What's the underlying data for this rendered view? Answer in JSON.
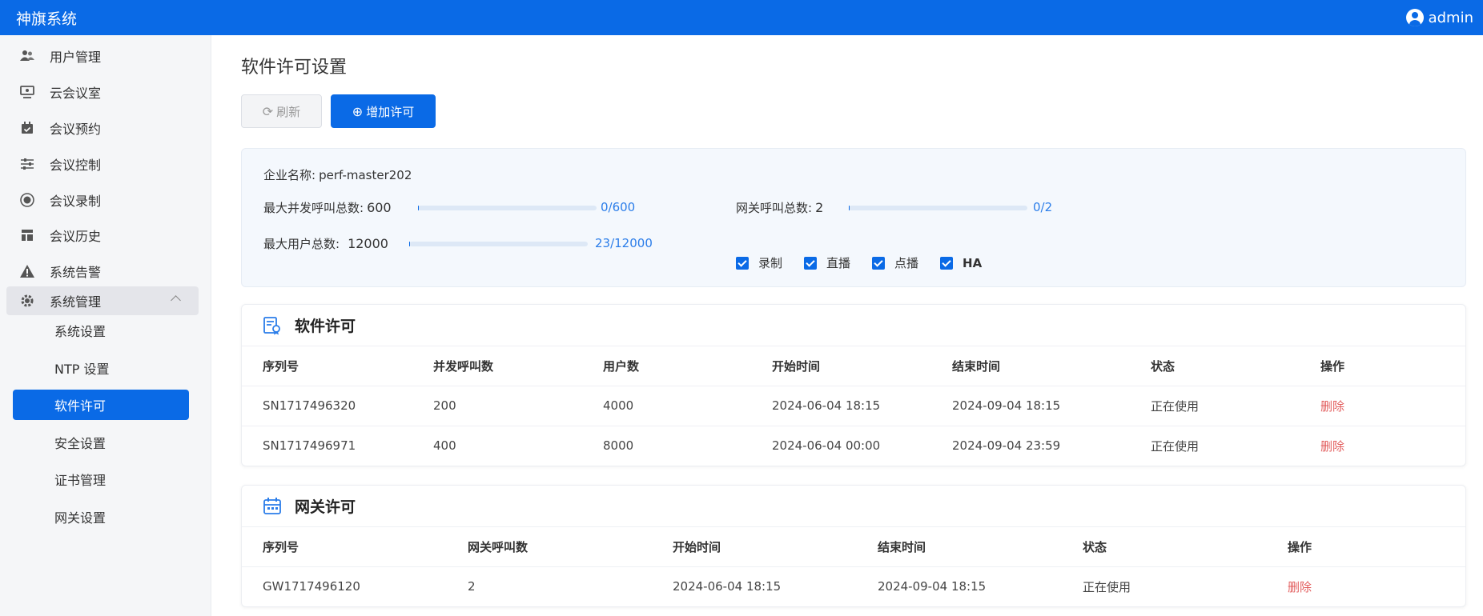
{
  "app": {
    "title": "神旗系统",
    "user": "admin"
  },
  "sidebar": {
    "items": [
      {
        "label": "用户管理",
        "icon": "users-icon"
      },
      {
        "label": "云会议室",
        "icon": "meeting-room-icon"
      },
      {
        "label": "会议预约",
        "icon": "calendar-check-icon"
      },
      {
        "label": "会议控制",
        "icon": "sliders-icon"
      },
      {
        "label": "会议录制",
        "icon": "record-icon"
      },
      {
        "label": "会议历史",
        "icon": "history-layout-icon"
      },
      {
        "label": "系统告警",
        "icon": "warning-icon"
      },
      {
        "label": "系统管理",
        "icon": "gear-icon"
      }
    ],
    "subitems": [
      {
        "label": "系统设置"
      },
      {
        "label": "NTP 设置"
      },
      {
        "label": "软件许可"
      },
      {
        "label": "安全设置"
      },
      {
        "label": "证书管理"
      },
      {
        "label": "网关设置"
      }
    ]
  },
  "page": {
    "title": "软件许可设置",
    "refresh_label": "刷新",
    "add_label": "增加许可"
  },
  "summary": {
    "company_label": "企业名称:",
    "company_value": "perf-master202",
    "max_calls_label": "最大并发呼叫总数:",
    "max_calls_value": "600",
    "max_calls_progress": "0/600",
    "max_calls_fraction": 0.0,
    "max_users_label": "最大用户总数:",
    "max_users_value": "12000",
    "max_users_progress": "23/12000",
    "max_users_fraction": 0.0019,
    "gateway_calls_label": "网关呼叫总数:",
    "gateway_calls_value": "2",
    "gateway_calls_progress": "0/2",
    "gateway_calls_fraction": 0.0,
    "features": [
      {
        "label": "录制",
        "checked": true
      },
      {
        "label": "直播",
        "checked": true
      },
      {
        "label": "点播",
        "checked": true
      },
      {
        "label": "HA",
        "checked": true
      }
    ]
  },
  "software_license": {
    "title": "软件许可",
    "headers": [
      "序列号",
      "并发呼叫数",
      "用户数",
      "开始时间",
      "结束时间",
      "状态",
      "操作"
    ],
    "rows": [
      [
        "SN1717496320",
        "200",
        "4000",
        "2024-06-04 18:15",
        "2024-09-04 18:15",
        "正在使用",
        "删除"
      ],
      [
        "SN1717496971",
        "400",
        "8000",
        "2024-06-04 00:00",
        "2024-09-04 23:59",
        "正在使用",
        "删除"
      ]
    ]
  },
  "gateway_license": {
    "title": "网关许可",
    "headers": [
      "序列号",
      "网关呼叫数",
      "开始时间",
      "结束时间",
      "状态",
      "操作"
    ],
    "rows": [
      [
        "GW1717496120",
        "2",
        "2024-06-04 18:15",
        "2024-09-04 18:15",
        "正在使用",
        "删除"
      ]
    ]
  },
  "colors": {
    "primary": "#0a6ae6",
    "danger": "#e25c5c",
    "link": "#2b7de9"
  }
}
